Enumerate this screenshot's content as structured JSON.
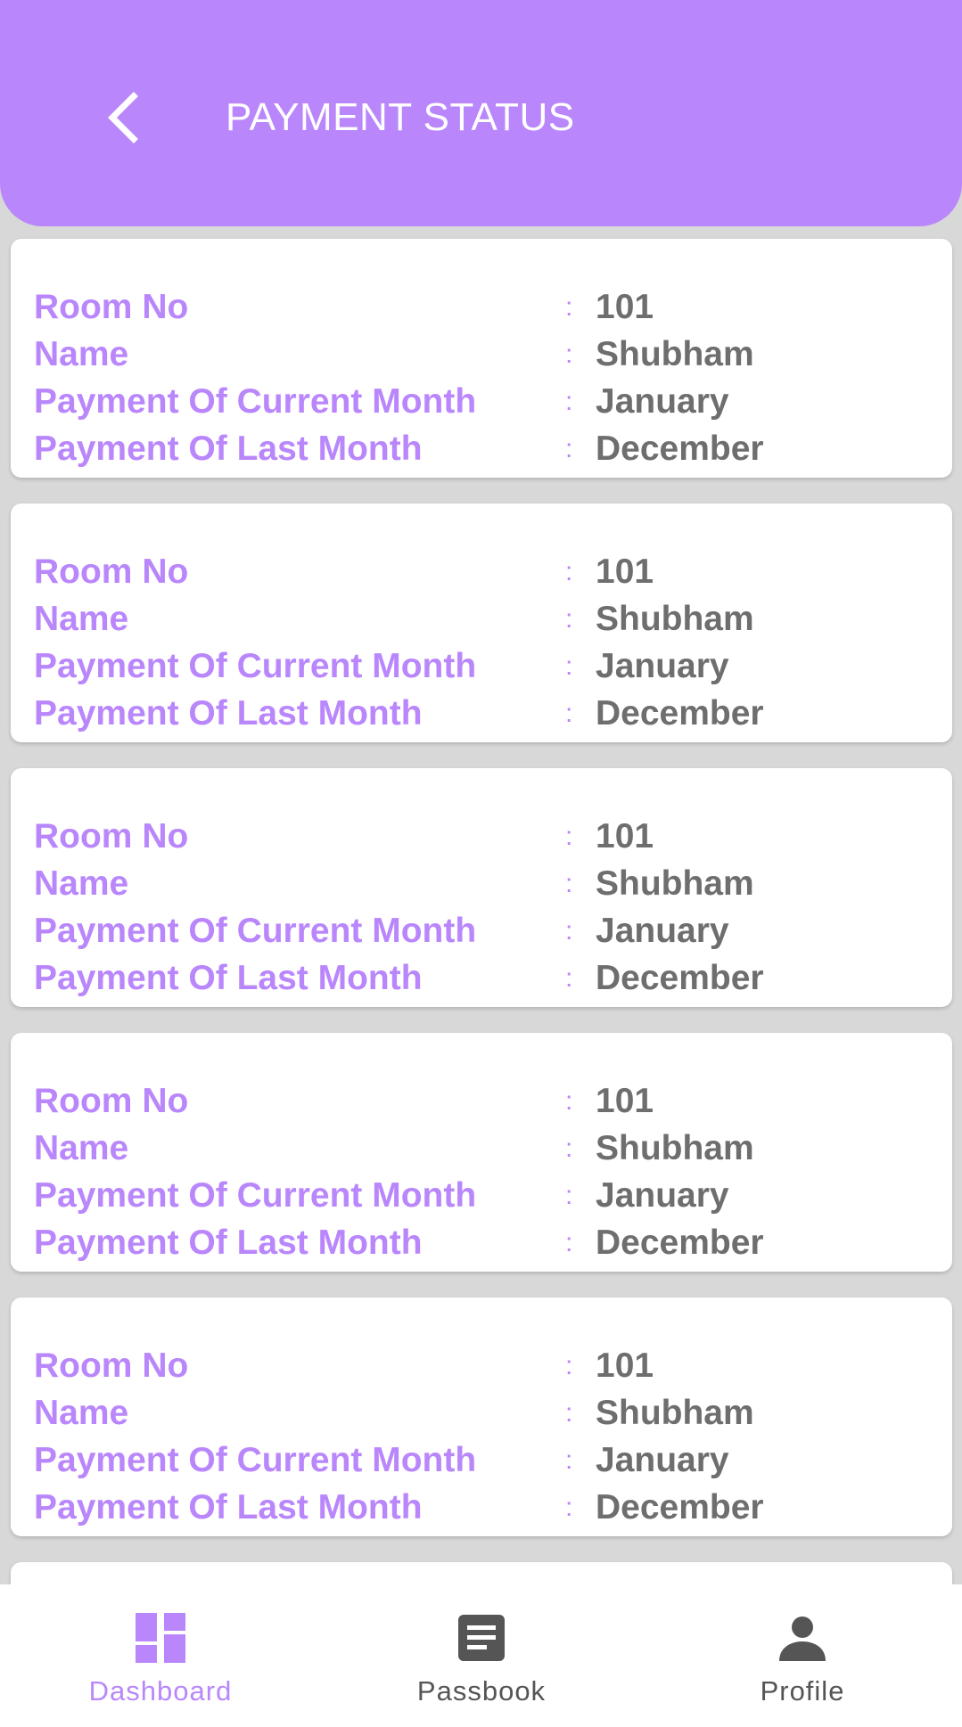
{
  "header": {
    "title": "PAYMENT STATUS",
    "back_icon": "chevron-left-icon",
    "color": "#b987fb"
  },
  "colors": {
    "accent": "#b987fb",
    "value_text": "#6e6e6e",
    "nav_inactive": "#555555",
    "background": "#d8d8d8"
  },
  "cards": [
    {
      "fields": [
        {
          "label": "Room No",
          "sep": ":",
          "value": "101"
        },
        {
          "label": "Name",
          "sep": ":",
          "value": "Shubham"
        },
        {
          "label": "Payment Of Current Month",
          "sep": ":",
          "value": "January"
        },
        {
          "label": "Payment Of Last Month",
          "sep": ":",
          "value": "December"
        }
      ]
    },
    {
      "fields": [
        {
          "label": "Room No",
          "sep": ":",
          "value": "101"
        },
        {
          "label": "Name",
          "sep": ":",
          "value": "Shubham"
        },
        {
          "label": "Payment Of Current Month",
          "sep": ":",
          "value": "January"
        },
        {
          "label": "Payment Of Last Month",
          "sep": ":",
          "value": "December"
        }
      ]
    },
    {
      "fields": [
        {
          "label": "Room No",
          "sep": ":",
          "value": "101"
        },
        {
          "label": "Name",
          "sep": ":",
          "value": "Shubham"
        },
        {
          "label": "Payment Of Current Month",
          "sep": ":",
          "value": "January"
        },
        {
          "label": "Payment Of Last Month",
          "sep": ":",
          "value": "December"
        }
      ]
    },
    {
      "fields": [
        {
          "label": "Room No",
          "sep": ":",
          "value": "101"
        },
        {
          "label": "Name",
          "sep": ":",
          "value": "Shubham"
        },
        {
          "label": "Payment Of Current Month",
          "sep": ":",
          "value": "January"
        },
        {
          "label": "Payment Of Last Month",
          "sep": ":",
          "value": "December"
        }
      ]
    },
    {
      "fields": [
        {
          "label": "Room No",
          "sep": ":",
          "value": "101"
        },
        {
          "label": "Name",
          "sep": ":",
          "value": "Shubham"
        },
        {
          "label": "Payment Of Current Month",
          "sep": ":",
          "value": "January"
        },
        {
          "label": "Payment Of Last Month",
          "sep": ":",
          "value": "December"
        }
      ]
    },
    {
      "fields": []
    }
  ],
  "bottom_nav": {
    "items": [
      {
        "label": "Dashboard",
        "icon": "dashboard-icon",
        "active": true
      },
      {
        "label": "Passbook",
        "icon": "passbook-icon",
        "active": false
      },
      {
        "label": "Profile",
        "icon": "profile-icon",
        "active": false
      }
    ]
  }
}
